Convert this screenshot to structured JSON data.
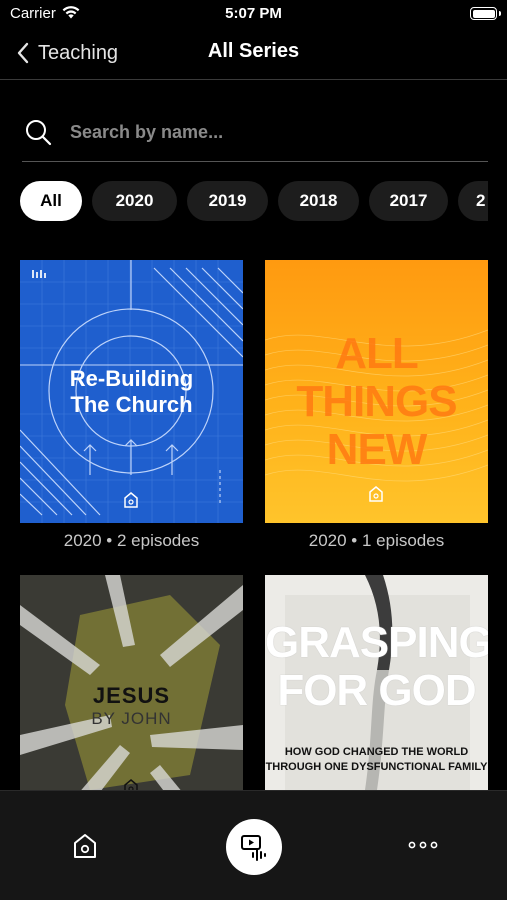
{
  "status_bar": {
    "carrier": "Carrier",
    "time": "5:07 PM"
  },
  "nav": {
    "back_label": "Teaching",
    "title": "All Series"
  },
  "search": {
    "placeholder": "Search by name...",
    "value": ""
  },
  "filters": {
    "selected": "All",
    "items": [
      "All",
      "2020",
      "2019",
      "2018",
      "2017",
      "2"
    ]
  },
  "series": [
    {
      "title_lines": [
        "Re-Building",
        "The Church"
      ],
      "meta": "2020 • 2 episodes",
      "style": "blue"
    },
    {
      "title_lines": [
        "ALL",
        "THINGS",
        "NEW"
      ],
      "meta": "2020 • 1 episodes",
      "style": "orange"
    },
    {
      "title": "JESUS",
      "subtitle": "BY JOHN",
      "style": "jesus"
    },
    {
      "title_lines": [
        "GRASPING",
        "FOR GOD"
      ],
      "subtitle_lines": [
        "HOW GOD CHANGED THE WORLD",
        "THROUGH ONE DYSFUNCTIONAL FAMILY"
      ],
      "style": "grasp"
    }
  ],
  "tab_bar": {
    "items": [
      {
        "icon": "home-icon",
        "active": false
      },
      {
        "icon": "media-icon",
        "active": true
      },
      {
        "icon": "more-icon",
        "active": false
      }
    ]
  },
  "colors": {
    "background": "#000000",
    "chip_active": "#ffffff",
    "chip_inactive": "#1d1d1d",
    "blue_art": "#1f5fce",
    "orange_art": "#ff9a10"
  }
}
